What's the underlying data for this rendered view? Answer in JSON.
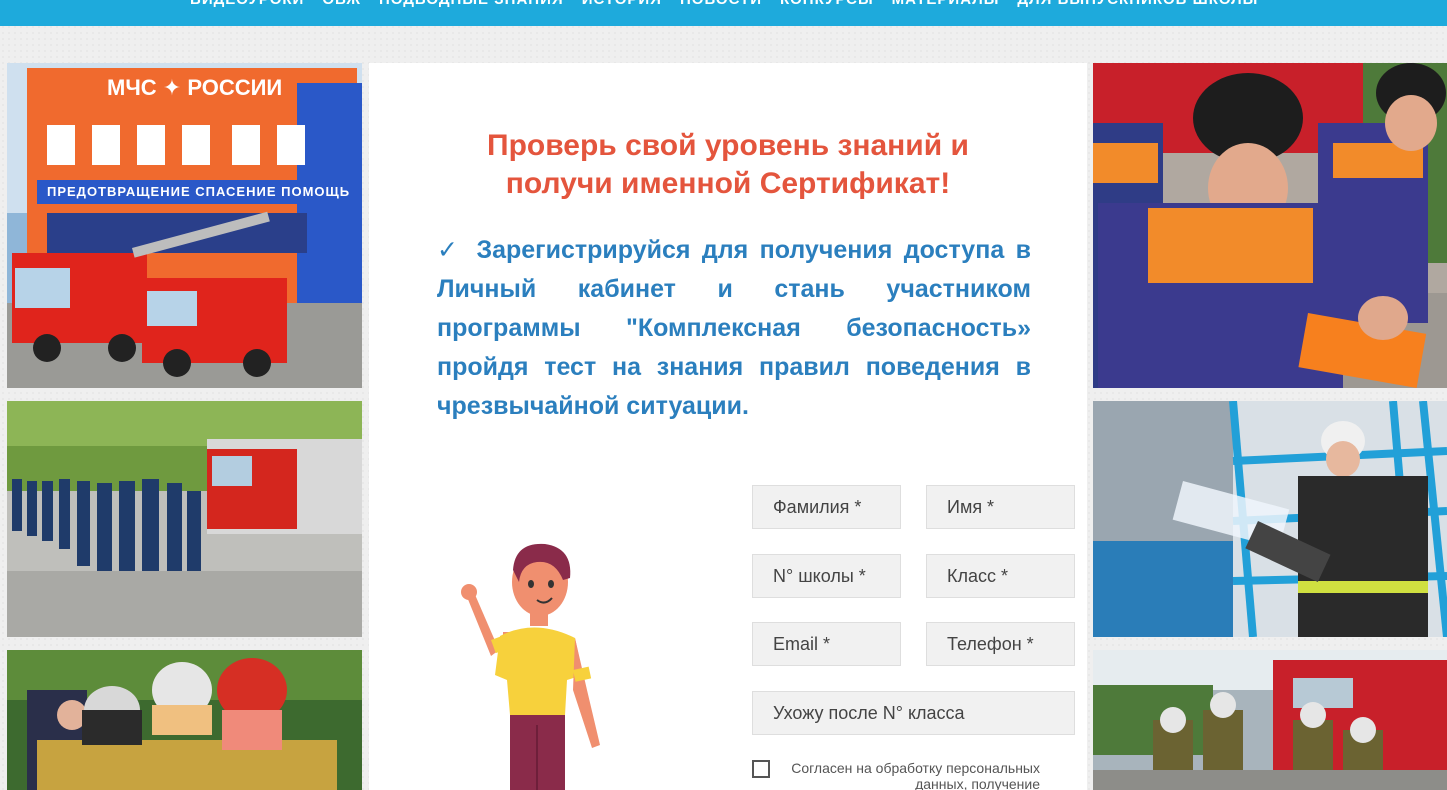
{
  "nav": {
    "items": [
      "ВИДЕОУРОКИ",
      "ОБЖ",
      "ПОДВОДНЫЕ ЗНАНИЯ",
      "ИСТОРИЯ",
      "НОВОСТИ",
      "КОНКУРСЫ",
      "МАТЕРИАЛЫ",
      "ДЛЯ ВЫПУСКНИКОВ ШКОЛЫ"
    ]
  },
  "photos": {
    "station_sign": "МЧС ✦ РОССИИ",
    "station_banner": "ПРЕДОТВРАЩЕНИЕ СПАСЕНИЕ ПОМОЩЬ"
  },
  "main": {
    "headline_line1": "Проверь свой уровень знаний и",
    "headline_line2": "получи именной Сертификат!",
    "check_mark": "✓",
    "intro": "Зарегистрируйся для получения доступа в Личный кабинет и стань участником программы \"Комплексная безопасность» пройдя тест на знания правил поведения в чрезвычайной ситуации."
  },
  "form": {
    "surname": "Фамилия *",
    "name": "Имя *",
    "school": "N° школы *",
    "grade": "Класс *",
    "email": "Email *",
    "phone": "Телефон *",
    "leave_after": "Ухожу после N° класса",
    "consent": "Согласен на обработку персональных данных, получение"
  },
  "colors": {
    "topbar": "#1eaadc",
    "headline": "#e4553d",
    "intro": "#2b7fbe"
  }
}
